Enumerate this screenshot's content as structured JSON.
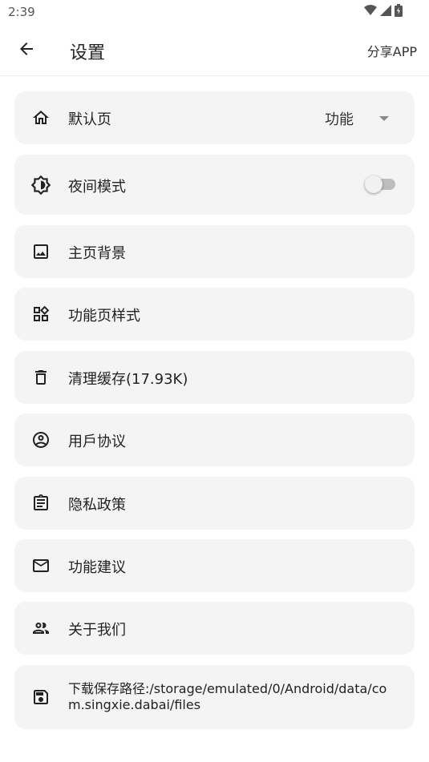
{
  "status_bar": {
    "time": "2:39",
    "icons": [
      "wifi-icon",
      "cellular-signal-icon",
      "battery-icon"
    ]
  },
  "app_bar": {
    "back_icon": "arrow-left-icon",
    "title": "设置",
    "share_label": "分享APP"
  },
  "settings": {
    "default_page": {
      "icon": "home-icon",
      "label": "默认页",
      "value": "功能"
    },
    "night_mode": {
      "icon": "brightness-icon",
      "label": "夜间模式",
      "enabled": false
    },
    "home_background": {
      "icon": "image-icon",
      "label": "主页背景"
    },
    "feature_style": {
      "icon": "widgets-icon",
      "label": "功能页样式"
    },
    "clear_cache": {
      "icon": "trash-icon",
      "label": "清理缓存(17.93K)"
    },
    "user_agreement": {
      "icon": "account-circle-icon",
      "label": "用戶协议"
    },
    "privacy_policy": {
      "icon": "clipboard-icon",
      "label": "隐私政策"
    },
    "feedback": {
      "icon": "mail-icon",
      "label": "功能建议"
    },
    "about": {
      "icon": "people-icon",
      "label": "关于我们"
    },
    "download_path": {
      "icon": "save-icon",
      "label": "下载保存路径:/storage/emulated/0/Android/data/com.singxie.dabai/files"
    }
  }
}
